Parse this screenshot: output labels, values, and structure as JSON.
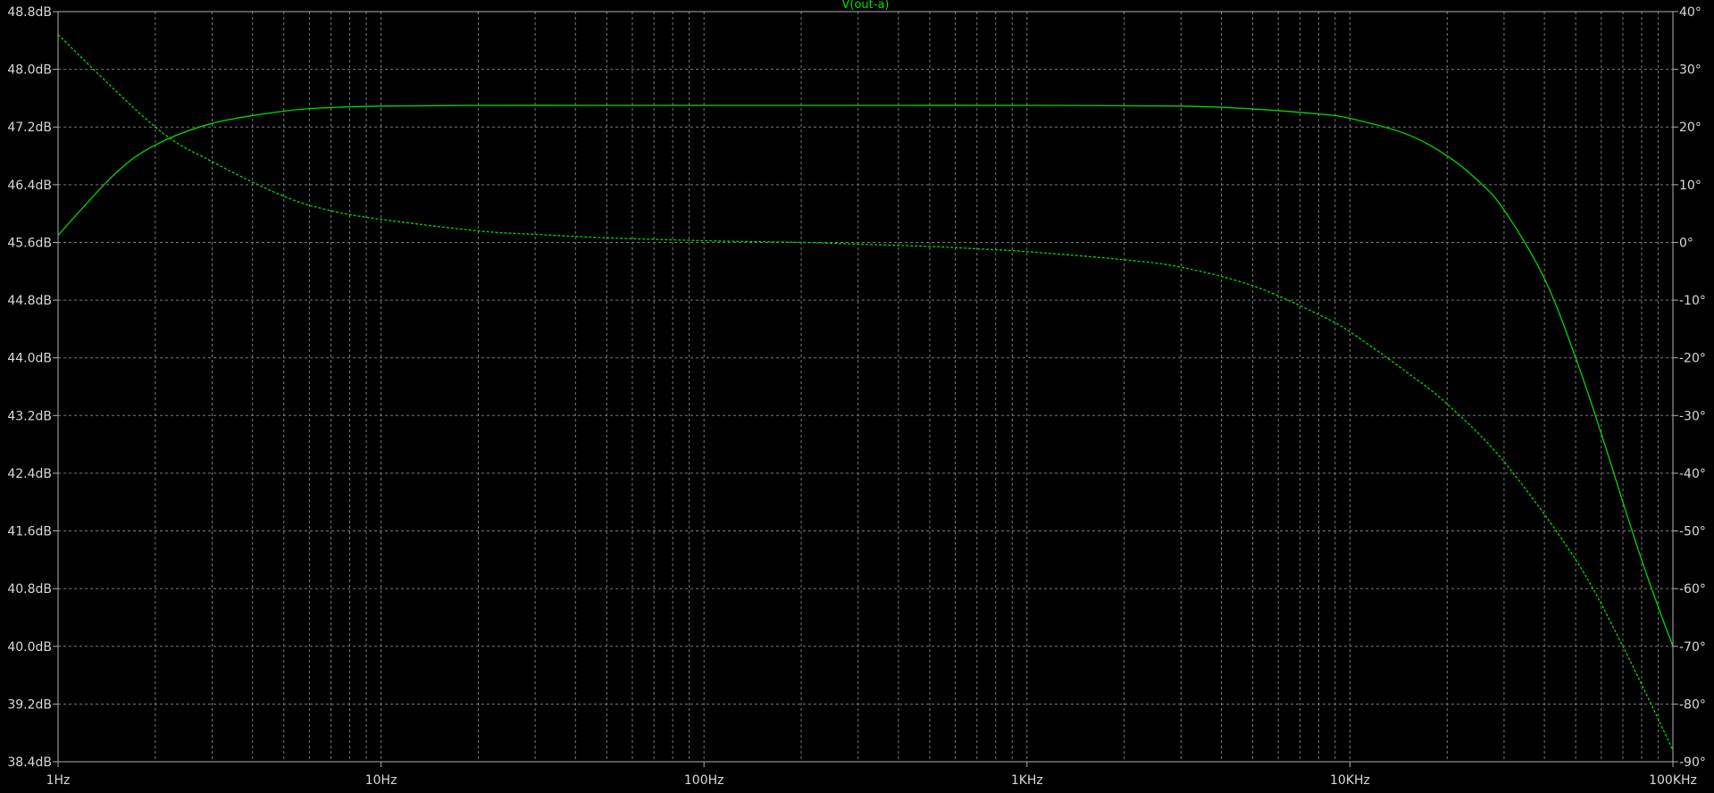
{
  "title": "V(out-a)",
  "colors": {
    "background": "#000000",
    "frame": "#b0b0b0",
    "grid": "#7a7a7a",
    "labels": "#d8d8d8",
    "trace": "#00d800",
    "title": "#00e000"
  },
  "chart_data": {
    "type": "line",
    "title": "V(out-a)",
    "x_scale": "log",
    "xlim": [
      1,
      100000
    ],
    "x_tick_values": [
      1,
      10,
      100,
      1000,
      10000,
      100000
    ],
    "x_tick_labels": [
      "1Hz",
      "10Hz",
      "100Hz",
      "1KHz",
      "10KHz",
      "100KHz"
    ],
    "y_left": {
      "unit": "dB",
      "ylim": [
        38.4,
        48.8
      ],
      "tick_values": [
        48.8,
        48.0,
        47.2,
        46.4,
        45.6,
        44.8,
        44.0,
        43.2,
        42.4,
        41.6,
        40.8,
        40.0,
        39.2,
        38.4
      ],
      "tick_labels": [
        "48.8dB",
        "48.0dB",
        "47.2dB",
        "46.4dB",
        "45.6dB",
        "44.8dB",
        "44.0dB",
        "43.2dB",
        "42.4dB",
        "41.6dB",
        "40.8dB",
        "40.0dB",
        "39.2dB",
        "38.4dB"
      ]
    },
    "y_right": {
      "unit": "°",
      "ylim": [
        -90,
        40
      ],
      "tick_values": [
        40,
        30,
        20,
        10,
        0,
        -10,
        -20,
        -30,
        -40,
        -50,
        -60,
        -70,
        -80,
        -90
      ],
      "tick_labels": [
        "40°",
        "30°",
        "20°",
        "10°",
        "0°",
        "-10°",
        "-20°",
        "-30°",
        "-40°",
        "-50°",
        "-60°",
        "-70°",
        "-80°",
        "-90°"
      ]
    },
    "grid": true,
    "series": [
      {
        "name": "V(out-a) magnitude",
        "axis": "left",
        "style": "solid",
        "x": [
          1,
          1.5,
          2,
          3,
          5,
          7,
          10,
          20,
          50,
          100,
          300,
          1000,
          3000,
          5000,
          8000,
          10000,
          15000,
          20000,
          25000,
          30000,
          40000,
          50000,
          60000,
          70000,
          80000,
          90000,
          100000
        ],
        "y": [
          45.7,
          46.55,
          46.95,
          47.25,
          47.42,
          47.47,
          47.49,
          47.5,
          47.5,
          47.5,
          47.5,
          47.5,
          47.49,
          47.45,
          47.38,
          47.32,
          47.1,
          46.8,
          46.45,
          46.05,
          45.1,
          44.0,
          42.95,
          42.0,
          41.2,
          40.55,
          40.0
        ]
      },
      {
        "name": "V(out-a) phase",
        "axis": "right",
        "style": "dashed",
        "x": [
          1,
          2,
          3,
          5,
          7,
          10,
          20,
          30,
          50,
          100,
          200,
          300,
          500,
          700,
          1000,
          2000,
          3000,
          5000,
          8000,
          10000,
          15000,
          20000,
          30000,
          50000,
          70000,
          100000
        ],
        "y": [
          36,
          20,
          14,
          8,
          5.5,
          4,
          2,
          1.4,
          0.8,
          0.3,
          0,
          -0.3,
          -0.7,
          -1.1,
          -1.6,
          -3,
          -4.3,
          -7.5,
          -12.5,
          -15.5,
          -22.5,
          -28,
          -38,
          -55,
          -70,
          -88
        ]
      }
    ]
  }
}
